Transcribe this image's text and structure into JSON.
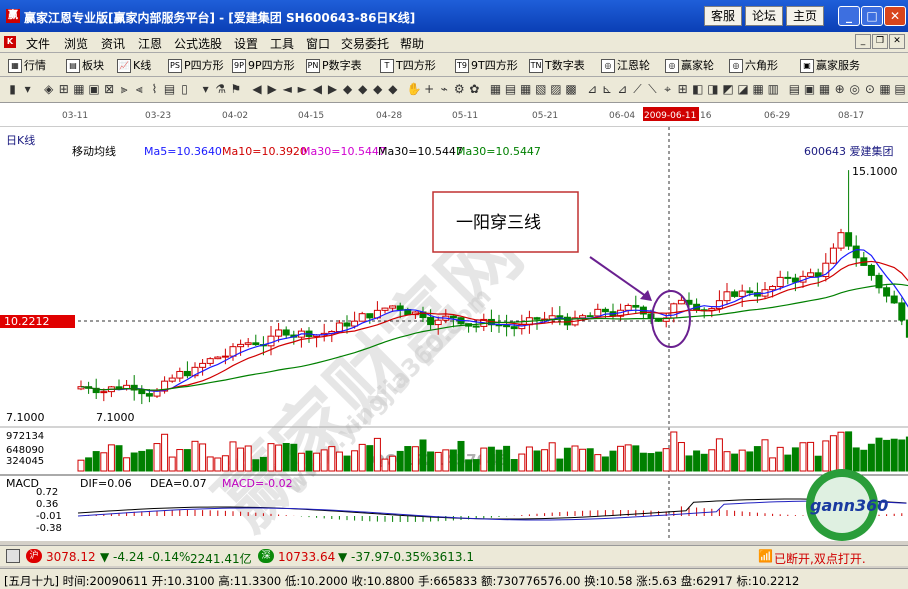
{
  "window": {
    "title": "赢家江恩专业版[赢家内部服务平台] - [爱建集团   SH600643-86日K线]",
    "buttons": [
      "客服",
      "论坛",
      "主页"
    ]
  },
  "menu": [
    "文件",
    "浏览",
    "资讯",
    "江恩",
    "公式选股",
    "设置",
    "工具",
    "窗口",
    "交易委托",
    "帮助"
  ],
  "toolbar": [
    {
      "label": "行情",
      "icon": "quote-icon"
    },
    {
      "label": "板块",
      "icon": "sector-icon"
    },
    {
      "label": "K线",
      "icon": "kline-icon"
    },
    {
      "label": "P四方形",
      "icon": "PS"
    },
    {
      "label": "9P四方形",
      "icon": "9P"
    },
    {
      "label": "P数字表",
      "icon": "PN"
    },
    {
      "label": "T四方形",
      "icon": "T"
    },
    {
      "label": "9T四方形",
      "icon": "T9"
    },
    {
      "label": "T数字表",
      "icon": "TN"
    },
    {
      "label": "江恩轮",
      "icon": "wheel-icon"
    },
    {
      "label": "赢家轮",
      "icon": "wheel-icon"
    },
    {
      "label": "六角形",
      "icon": "hexagon-icon"
    },
    {
      "label": "赢家服务",
      "icon": "service-icon"
    }
  ],
  "chart": {
    "dates": [
      "03-11",
      "03-23",
      "04-02",
      "04-15",
      "04-28",
      "05-11",
      "05-21",
      "06-04",
      "2009-06-11",
      "16",
      "06-29",
      "08-17"
    ],
    "panel_label": "日K线",
    "ma_title": "移动均线",
    "ma_legend": [
      {
        "text": "Ma5=10.3640",
        "color": "#1a1aff"
      },
      {
        "text": "Ma10=10.3920",
        "color": "#d00000"
      },
      {
        "text": "Ma30=10.5447",
        "color": "#d000d0"
      },
      {
        "text": "Ma30=10.5447",
        "color": "#000000"
      },
      {
        "text": "Ma30=10.5447",
        "color": "#008000"
      }
    ],
    "stock": "600643  爱建集团",
    "high_label": "15.1000",
    "low_label": "7.1000",
    "low_label2": "7.1000",
    "cursor_price": "10.2212",
    "annotation": "一阳穿三线",
    "vol_ticks": [
      "972134",
      "648090",
      "324045"
    ],
    "macd": {
      "title": "MACD",
      "dif": "DIF=0.06",
      "dea": "DEA=0.07",
      "macd": "MACD=-0.02",
      "ticks": [
        "0.72",
        "0.36",
        "-0.01",
        "-0.38"
      ]
    },
    "watermarks": [
      "赢家财富网",
      "www.yingjia360.com",
      "QQ:1721457646"
    ],
    "logo_text": "gann360"
  },
  "status": {
    "idx1_val": "3078.12",
    "idx1_chg": "▼ -4.24",
    "idx1_pct": "-0.14%",
    "idx1_amt": "2241.41亿",
    "idx2_val": "10733.64",
    "idx2_chg": "▼ -37.97",
    "idx2_pct": "-0.35%",
    "idx2_amt": "3613.1",
    "conn": "已断开,双点打开."
  },
  "info": "[五月十九] 时间:20090611 开:10.3100 高:11.3300 低:10.2000 收:10.8800 手:665833 额:730776576.00 换:10.58 涨:5.63 盘:62917 标:10.2212",
  "colors": {
    "up": "#d00000",
    "down": "#008000",
    "ma5": "#1a1aff",
    "ma10": "#d00000",
    "ma30": "#008000",
    "watermark": "#b5b5b5"
  }
}
